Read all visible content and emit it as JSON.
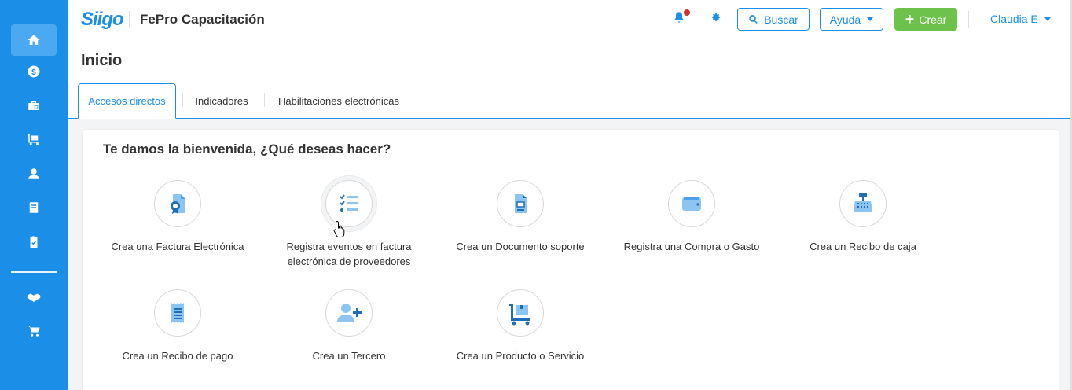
{
  "header": {
    "logo_text": "Siigo",
    "company": "FePro Capacitación",
    "search_label": "Buscar",
    "help_label": "Ayuda",
    "create_label": "Crear",
    "user_label": "Claudia E"
  },
  "sidebar": {
    "items": [
      {
        "icon": "home-icon",
        "active": true
      },
      {
        "icon": "dollar-icon"
      },
      {
        "icon": "briefcase-icon"
      },
      {
        "icon": "truck-cart-icon"
      },
      {
        "icon": "person-icon"
      },
      {
        "icon": "book-icon"
      },
      {
        "icon": "clipboard-check-icon"
      },
      {
        "icon": "handshake-icon"
      },
      {
        "icon": "shopping-cart-icon"
      }
    ]
  },
  "page": {
    "title": "Inicio",
    "tabs": [
      "Accesos directos",
      "Indicadores",
      "Habilitaciones electrónicas"
    ],
    "active_tab": "Accesos directos"
  },
  "welcome": {
    "title": "Te damos la bienvenida, ¿Qué deseas hacer?",
    "actions": [
      {
        "label": "Crea una Factura Electrónica",
        "icon": "invoice-icon"
      },
      {
        "label": "Registra eventos en factura electrónica de proveedores",
        "icon": "checklist-icon"
      },
      {
        "label": "Crea un Documento soporte",
        "icon": "document-icon"
      },
      {
        "label": "Registra una Compra o Gasto",
        "icon": "wallet-icon"
      },
      {
        "label": "Crea un Recibo de caja",
        "icon": "cash-register-icon"
      },
      {
        "label": "Crea un Recibo de pago",
        "icon": "receipt-icon"
      },
      {
        "label": "Crea un Tercero",
        "icon": "add-person-icon"
      },
      {
        "label": "Crea un Producto o Servicio",
        "icon": "product-cart-icon"
      }
    ]
  },
  "colors": {
    "brand_blue": "#1b8fe8",
    "create_green": "#6cc24a",
    "notification_red": "#d32f2f"
  }
}
